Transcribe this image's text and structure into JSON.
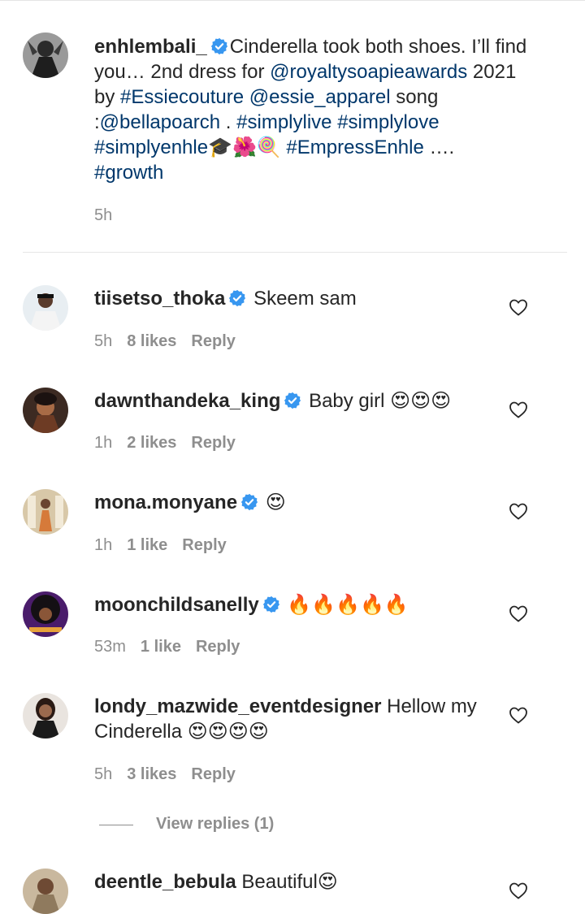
{
  "post": {
    "username": "enhlembali_",
    "caption_part1": "Cinderella took both shoes. I’ll find you… 2nd dress for ",
    "mention1": "@royaltysoapieawards",
    "caption_part2": " 2021 by ",
    "hashtag1": "#Essiecouture",
    "space1": " ",
    "mention2": "@essie_apparel",
    "caption_part3": " song :",
    "mention3": "@bellapoarch",
    "caption_part4": " . ",
    "hashtag2": "#simplylive",
    "space2": " ",
    "hashtag3": "#simplylove",
    "space3": " ",
    "hashtag4": "#simplyenhle",
    "emoji_string": "🎓🌺🍭",
    "hashtag5": "#EmpressEnhle",
    "caption_part5": " ….",
    "hashtag6": "#growth",
    "time": "5h"
  },
  "comments": [
    {
      "username": "tiisetso_thoka",
      "text": "Skeem sam",
      "time": "5h",
      "likes": "8 likes",
      "reply": "Reply"
    },
    {
      "username": "dawnthandeka_king",
      "text": "Baby girl",
      "time": "1h",
      "likes": "2 likes",
      "reply": "Reply",
      "emoji": "😍😍😍"
    },
    {
      "username": "mona.monyane",
      "text": "",
      "time": "1h",
      "likes": "1 like",
      "reply": "Reply",
      "emoji": "😍"
    },
    {
      "username": "moonchildsanelly",
      "text": "",
      "time": "53m",
      "likes": "1 like",
      "reply": "Reply",
      "emoji": "🔥🔥🔥🔥🔥"
    },
    {
      "username": "londy_mazwide_eventdesigner",
      "text": "Hellow my Cinderella",
      "time": "5h",
      "likes": "3 likes",
      "reply": "Reply",
      "emoji": "😍😍😍😍"
    },
    {
      "username": "deentle_bebula",
      "text": "Beautiful",
      "emoji": "😍"
    }
  ],
  "view_replies": "View replies (1)",
  "colors": {
    "link": "#00376b",
    "verified": "#3897f0",
    "muted": "#8e8e8e",
    "text": "#262626"
  },
  "icons": [
    "verified-badge-icon",
    "heart-outline-icon",
    "heart-eyes-emoji",
    "fire-emoji"
  ]
}
